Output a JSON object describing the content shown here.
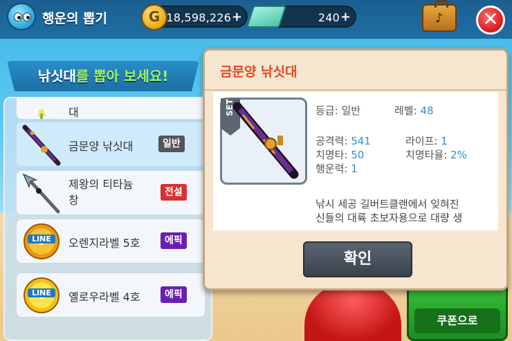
{
  "header": {
    "title": "행운의 뽑기",
    "gold": "18,598,226",
    "gold_icon": "G",
    "cash": "240",
    "plus": "+",
    "close": "✕"
  },
  "banner": {
    "part1": "낚싯대",
    "part2": "를 뽑아 보세요!"
  },
  "list": {
    "partial_name": "대",
    "items": [
      {
        "name": "금문양 낚싯대",
        "grade": "일반"
      },
      {
        "name": "제왕의 티타늄",
        "name2": "창",
        "grade": "전설"
      },
      {
        "name": "오렌지라벨 5호",
        "grade": "에픽",
        "spool_text": "LINE",
        "spool_num": "5"
      },
      {
        "name": "옐로우라벨 4호",
        "grade": "에픽",
        "spool_text": "LINE",
        "spool_num": "4"
      }
    ]
  },
  "background": {
    "coupon": "쿠폰으로"
  },
  "modal": {
    "title": "금문양 낚싯대",
    "set_tag": "SET",
    "grade_label": "등급:",
    "grade_value": "일반",
    "level_label": "레벨:",
    "level_value": "48",
    "attack_label": "공격력:",
    "attack_value": "541",
    "life_label": "라이프:",
    "life_value": "1",
    "crit_label": "치명타:",
    "crit_value": "50",
    "critrate_label": "치명타율:",
    "critrate_value": "2%",
    "luck_label": "행운력:",
    "luck_value": "1",
    "desc_line1": "낚시 세공 길버트클랜에서 잊혀진",
    "desc_line2": "신들의 대륙 초보자용으로 대량 생",
    "confirm": "확인"
  },
  "colors": {
    "accent": "#2a8fd6",
    "title_red": "#e24722",
    "legend": "#d93030",
    "epic": "#6a1fb3",
    "normal": "#555555"
  }
}
